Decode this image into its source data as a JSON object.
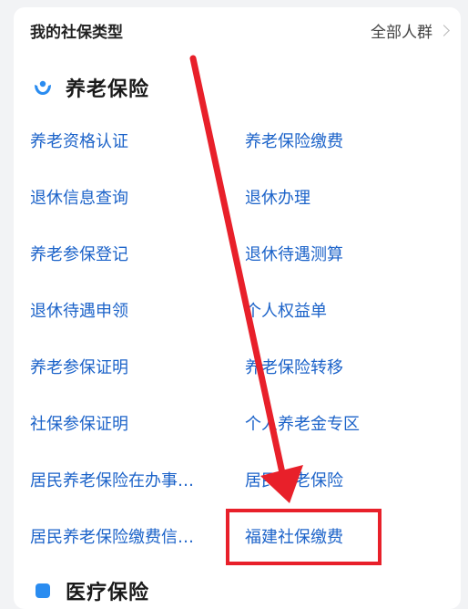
{
  "header": {
    "title": "我的社保类型",
    "all_groups_label": "全部人群"
  },
  "sections": [
    {
      "icon": "pension-hands-icon",
      "title": "养老保险",
      "items": [
        [
          "养老资格认证",
          "养老保险缴费"
        ],
        [
          "退休信息查询",
          "退休办理"
        ],
        [
          "养老参保登记",
          "退休待遇测算"
        ],
        [
          "退休待遇申领",
          "个人权益单"
        ],
        [
          "养老参保证明",
          "养老保险转移"
        ],
        [
          "社保参保证明",
          "个人养老金专区"
        ],
        [
          "居民养老保险在办事…",
          "居民养老保险"
        ],
        [
          "居民养老保险缴费信…",
          "福建社保缴费"
        ]
      ]
    },
    {
      "icon": "medical-icon",
      "title": "医疗保险"
    }
  ],
  "colors": {
    "link": "#1c63c9",
    "highlight": "#e8202a",
    "icon": "#2a8cf0"
  }
}
